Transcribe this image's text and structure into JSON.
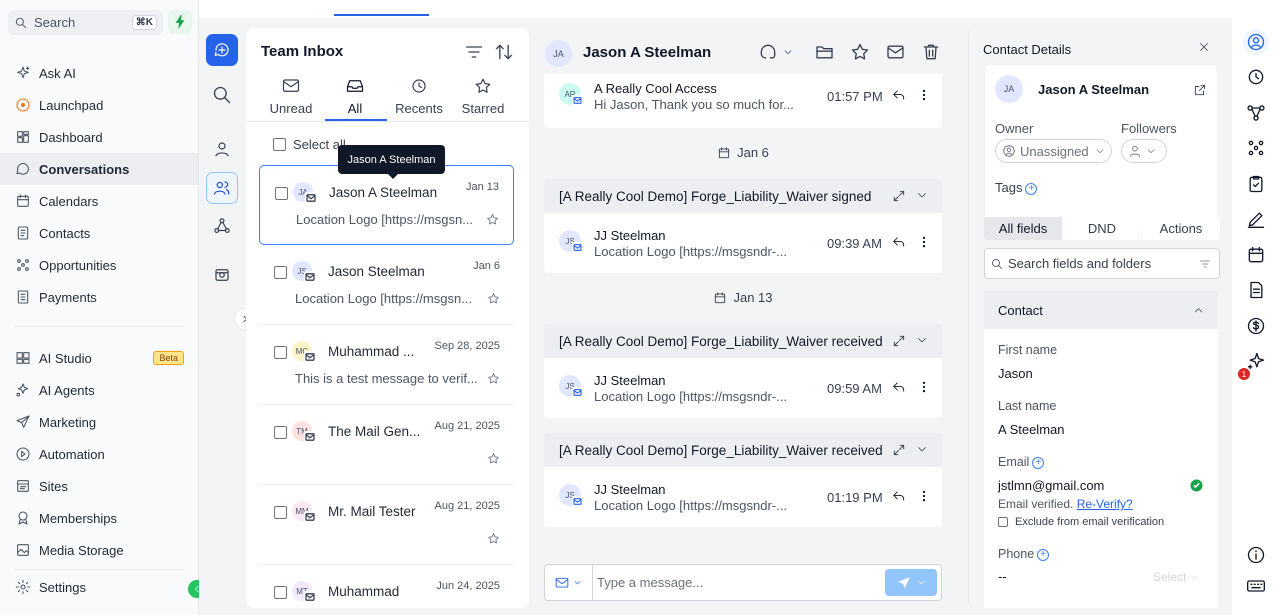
{
  "search": {
    "placeholder": "Search",
    "shortcut": "⌘K"
  },
  "sidebar": {
    "items": [
      {
        "label": "Ask AI",
        "icon": "sparkle-icon"
      },
      {
        "label": "Launchpad",
        "icon": "launchpad-icon"
      },
      {
        "label": "Dashboard",
        "icon": "dashboard-icon"
      },
      {
        "label": "Conversations",
        "icon": "chat-bubble-icon",
        "active": true
      },
      {
        "label": "Calendars",
        "icon": "calendar-icon"
      },
      {
        "label": "Contacts",
        "icon": "contacts-icon"
      },
      {
        "label": "Opportunities",
        "icon": "opportunities-icon"
      },
      {
        "label": "Payments",
        "icon": "payments-icon"
      },
      {
        "label": "AI Studio",
        "icon": "ai-studio-icon",
        "badge": "Beta"
      },
      {
        "label": "AI Agents",
        "icon": "ai-agents-icon"
      },
      {
        "label": "Marketing",
        "icon": "send-icon"
      },
      {
        "label": "Automation",
        "icon": "automation-icon"
      },
      {
        "label": "Sites",
        "icon": "sites-icon"
      },
      {
        "label": "Memberships",
        "icon": "memberships-icon"
      },
      {
        "label": "Media Storage",
        "icon": "media-icon"
      },
      {
        "label": "Settings",
        "icon": "settings-icon"
      }
    ]
  },
  "inbox": {
    "title": "Team Inbox",
    "tabs": [
      {
        "label": "Unread",
        "icon": "mail-icon"
      },
      {
        "label": "All",
        "icon": "inbox-icon",
        "active": true
      },
      {
        "label": "Recents",
        "icon": "clock-icon"
      },
      {
        "label": "Starred",
        "icon": "star-icon"
      }
    ],
    "select_all": "Select all",
    "tooltip": "Jason A Steelman",
    "conversations": [
      {
        "initials": "JA",
        "name": "Jason A Steelman",
        "date": "Jan 13",
        "preview": "Location Logo [https://msgsn...",
        "color": "#e0e7ff"
      },
      {
        "initials": "JS",
        "name": "Jason Steelman",
        "date": "Jan 6",
        "preview": "Location Logo [https://msgsn...",
        "color": "#e0e7ff"
      },
      {
        "initials": "MC",
        "name": "Muhammad ...",
        "date": "Sep 28, 2025",
        "preview": "This is a test message to verif...",
        "color": "#fef3c7"
      },
      {
        "initials": "TM",
        "name": "The Mail Gen...",
        "date": "Aug 21, 2025",
        "preview": "",
        "color": "#fee2e2"
      },
      {
        "initials": "MM",
        "name": "Mr. Mail Tester",
        "date": "Aug 21, 2025",
        "preview": "",
        "color": "#fce7f3"
      },
      {
        "initials": "MT",
        "name": "Muhammad",
        "date": "Jun 24, 2025",
        "preview": "",
        "color": "#f3e8ff"
      }
    ]
  },
  "conversation": {
    "contact_initials": "JA",
    "contact_name": "Jason A Steelman",
    "top_message": {
      "initials": "AR",
      "sender": "A Really Cool Access",
      "preview": "Hi Jason, Thank you so much for...",
      "time": "01:57 PM"
    },
    "date_jan6": "Jan 6",
    "date_jan13": "Jan 13",
    "cards": [
      {
        "header": "[A Really Cool Demo] Forge_Liability_Waiver signed",
        "initials": "JS",
        "sender": "JJ Steelman",
        "preview": "Location Logo [https://msgsndr-...",
        "time": "09:39 AM"
      },
      {
        "header": "[A Really Cool Demo] Forge_Liability_Waiver received",
        "initials": "JS",
        "sender": "JJ Steelman",
        "preview": "Location Logo [https://msgsndr-...",
        "time": "09:59 AM"
      },
      {
        "header": "[A Really Cool Demo] Forge_Liability_Waiver received",
        "initials": "JS",
        "sender": "JJ Steelman",
        "preview": "Location Logo [https://msgsndr-...",
        "time": "01:19 PM"
      }
    ],
    "composer_placeholder": "Type a message..."
  },
  "contact": {
    "title": "Contact Details",
    "initials": "JA",
    "name": "Jason A Steelman",
    "owner_label": "Owner",
    "owner_value": "Unassigned",
    "followers_label": "Followers",
    "tags_label": "Tags",
    "segments": [
      "All fields",
      "DND",
      "Actions"
    ],
    "search_placeholder": "Search fields and folders",
    "section": "Contact",
    "first_name_label": "First name",
    "first_name": "Jason",
    "last_name_label": "Last name",
    "last_name": "A Steelman",
    "email_label": "Email",
    "email": "jstlmn@gmail.com",
    "email_verified": "Email verified.",
    "reverify": "Re-Verify?",
    "exclude_label": "Exclude from email verification",
    "phone_label": "Phone",
    "phone_value": "--",
    "phone_select": "Select"
  },
  "right_rail": {
    "notification_count": "1"
  }
}
